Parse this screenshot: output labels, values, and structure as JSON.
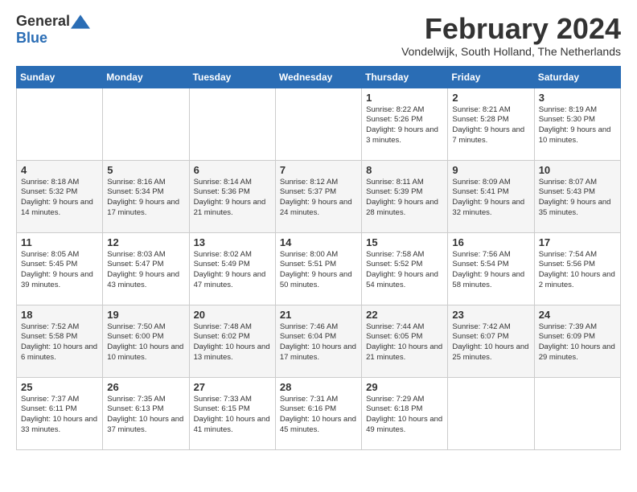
{
  "logo": {
    "text_general": "General",
    "text_blue": "Blue"
  },
  "title": "February 2024",
  "subtitle": "Vondelwijk, South Holland, The Netherlands",
  "headers": [
    "Sunday",
    "Monday",
    "Tuesday",
    "Wednesday",
    "Thursday",
    "Friday",
    "Saturday"
  ],
  "weeks": [
    [
      {
        "num": "",
        "info": ""
      },
      {
        "num": "",
        "info": ""
      },
      {
        "num": "",
        "info": ""
      },
      {
        "num": "",
        "info": ""
      },
      {
        "num": "1",
        "info": "Sunrise: 8:22 AM\nSunset: 5:26 PM\nDaylight: 9 hours and 3 minutes."
      },
      {
        "num": "2",
        "info": "Sunrise: 8:21 AM\nSunset: 5:28 PM\nDaylight: 9 hours and 7 minutes."
      },
      {
        "num": "3",
        "info": "Sunrise: 8:19 AM\nSunset: 5:30 PM\nDaylight: 9 hours and 10 minutes."
      }
    ],
    [
      {
        "num": "4",
        "info": "Sunrise: 8:18 AM\nSunset: 5:32 PM\nDaylight: 9 hours and 14 minutes."
      },
      {
        "num": "5",
        "info": "Sunrise: 8:16 AM\nSunset: 5:34 PM\nDaylight: 9 hours and 17 minutes."
      },
      {
        "num": "6",
        "info": "Sunrise: 8:14 AM\nSunset: 5:36 PM\nDaylight: 9 hours and 21 minutes."
      },
      {
        "num": "7",
        "info": "Sunrise: 8:12 AM\nSunset: 5:37 PM\nDaylight: 9 hours and 24 minutes."
      },
      {
        "num": "8",
        "info": "Sunrise: 8:11 AM\nSunset: 5:39 PM\nDaylight: 9 hours and 28 minutes."
      },
      {
        "num": "9",
        "info": "Sunrise: 8:09 AM\nSunset: 5:41 PM\nDaylight: 9 hours and 32 minutes."
      },
      {
        "num": "10",
        "info": "Sunrise: 8:07 AM\nSunset: 5:43 PM\nDaylight: 9 hours and 35 minutes."
      }
    ],
    [
      {
        "num": "11",
        "info": "Sunrise: 8:05 AM\nSunset: 5:45 PM\nDaylight: 9 hours and 39 minutes."
      },
      {
        "num": "12",
        "info": "Sunrise: 8:03 AM\nSunset: 5:47 PM\nDaylight: 9 hours and 43 minutes."
      },
      {
        "num": "13",
        "info": "Sunrise: 8:02 AM\nSunset: 5:49 PM\nDaylight: 9 hours and 47 minutes."
      },
      {
        "num": "14",
        "info": "Sunrise: 8:00 AM\nSunset: 5:51 PM\nDaylight: 9 hours and 50 minutes."
      },
      {
        "num": "15",
        "info": "Sunrise: 7:58 AM\nSunset: 5:52 PM\nDaylight: 9 hours and 54 minutes."
      },
      {
        "num": "16",
        "info": "Sunrise: 7:56 AM\nSunset: 5:54 PM\nDaylight: 9 hours and 58 minutes."
      },
      {
        "num": "17",
        "info": "Sunrise: 7:54 AM\nSunset: 5:56 PM\nDaylight: 10 hours and 2 minutes."
      }
    ],
    [
      {
        "num": "18",
        "info": "Sunrise: 7:52 AM\nSunset: 5:58 PM\nDaylight: 10 hours and 6 minutes."
      },
      {
        "num": "19",
        "info": "Sunrise: 7:50 AM\nSunset: 6:00 PM\nDaylight: 10 hours and 10 minutes."
      },
      {
        "num": "20",
        "info": "Sunrise: 7:48 AM\nSunset: 6:02 PM\nDaylight: 10 hours and 13 minutes."
      },
      {
        "num": "21",
        "info": "Sunrise: 7:46 AM\nSunset: 6:04 PM\nDaylight: 10 hours and 17 minutes."
      },
      {
        "num": "22",
        "info": "Sunrise: 7:44 AM\nSunset: 6:05 PM\nDaylight: 10 hours and 21 minutes."
      },
      {
        "num": "23",
        "info": "Sunrise: 7:42 AM\nSunset: 6:07 PM\nDaylight: 10 hours and 25 minutes."
      },
      {
        "num": "24",
        "info": "Sunrise: 7:39 AM\nSunset: 6:09 PM\nDaylight: 10 hours and 29 minutes."
      }
    ],
    [
      {
        "num": "25",
        "info": "Sunrise: 7:37 AM\nSunset: 6:11 PM\nDaylight: 10 hours and 33 minutes."
      },
      {
        "num": "26",
        "info": "Sunrise: 7:35 AM\nSunset: 6:13 PM\nDaylight: 10 hours and 37 minutes."
      },
      {
        "num": "27",
        "info": "Sunrise: 7:33 AM\nSunset: 6:15 PM\nDaylight: 10 hours and 41 minutes."
      },
      {
        "num": "28",
        "info": "Sunrise: 7:31 AM\nSunset: 6:16 PM\nDaylight: 10 hours and 45 minutes."
      },
      {
        "num": "29",
        "info": "Sunrise: 7:29 AM\nSunset: 6:18 PM\nDaylight: 10 hours and 49 minutes."
      },
      {
        "num": "",
        "info": ""
      },
      {
        "num": "",
        "info": ""
      }
    ]
  ]
}
